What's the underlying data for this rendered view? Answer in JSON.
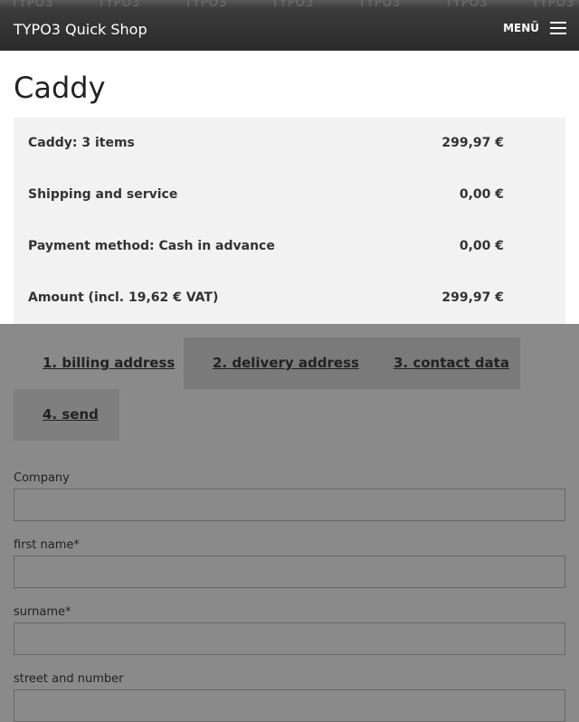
{
  "header": {
    "watermark": "TYPO3",
    "brand": "TYPO3 Quick Shop",
    "menu_label": "MENÜ"
  },
  "page": {
    "title": "Caddy"
  },
  "summary": [
    {
      "label": "Caddy: 3 items",
      "value": "299,97 €"
    },
    {
      "label": "Shipping and service",
      "value": "0,00 €"
    },
    {
      "label": "Payment method: Cash in advance",
      "value": "0,00 €"
    },
    {
      "label": "Amount (incl. 19,62 € VAT)",
      "value": "299,97 €"
    }
  ],
  "tabs": [
    {
      "label": "1. billing address",
      "state": "active"
    },
    {
      "label": "2. delivery address",
      "state": "inactive"
    },
    {
      "label": "3. contact data",
      "state": "inactive"
    },
    {
      "label": "4. send",
      "state": "inactive"
    }
  ],
  "form": {
    "company_label": "Company",
    "company_value": "",
    "first_name_label": "first name*",
    "first_name_value": "",
    "surname_label": "surname*",
    "surname_value": "",
    "street_label": "street and number",
    "street_value": ""
  }
}
